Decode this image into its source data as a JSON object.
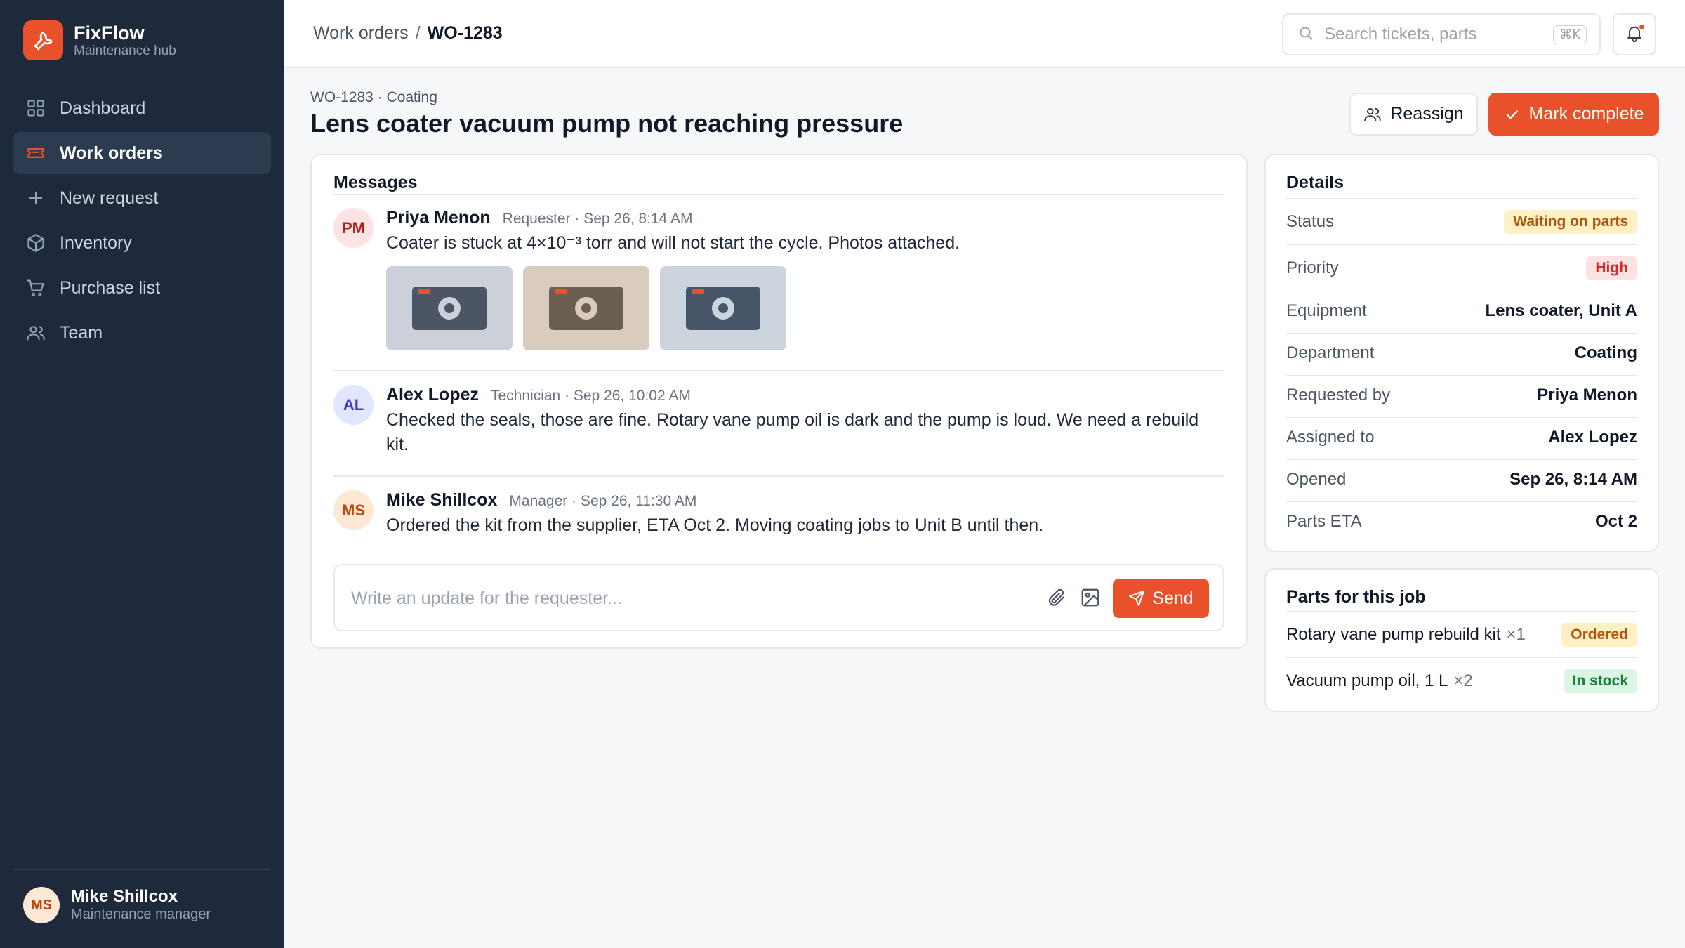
{
  "brand": {
    "name": "FixFlow",
    "subtitle": "Maintenance hub"
  },
  "nav": [
    {
      "label": "Dashboard",
      "icon": "grid-icon",
      "active": false
    },
    {
      "label": "Work orders",
      "icon": "ticket-icon",
      "active": true
    },
    {
      "label": "New request",
      "icon": "plus-icon",
      "active": false
    },
    {
      "label": "Inventory",
      "icon": "box-icon",
      "active": false
    },
    {
      "label": "Purchase list",
      "icon": "cart-icon",
      "active": false
    },
    {
      "label": "Team",
      "icon": "users-icon",
      "active": false
    }
  ],
  "user": {
    "initials": "MS",
    "name": "Mike Shillcox",
    "role": "Maintenance manager"
  },
  "breadcrumb": {
    "parent": "Work orders",
    "separator": "/",
    "current": "WO-1283"
  },
  "search": {
    "placeholder": "Search tickets, parts",
    "shortcut": "⌘K"
  },
  "header": {
    "meta": "WO-1283 · Coating",
    "title": "Lens coater vacuum pump not reaching pressure",
    "reassign_label": "Reassign",
    "complete_label": "Mark complete"
  },
  "messages": {
    "title": "Messages",
    "items": [
      {
        "initials": "PM",
        "name": "Priya Menon",
        "meta": "Requester · Sep 26, 8:14 AM",
        "text": "Coater is stuck at 4×10⁻³ torr and will not start the cycle. Photos attached."
      },
      {
        "initials": "AL",
        "name": "Alex Lopez",
        "meta": "Technician · Sep 26, 10:02 AM",
        "text": "Checked the seals, those are fine. Rotary vane pump oil is dark and the pump is loud. We need a rebuild kit."
      },
      {
        "initials": "MS",
        "name": "Mike Shillcox",
        "meta": "Manager · Sep 26, 11:30 AM",
        "text": "Ordered the kit from the supplier, ETA Oct 2. Moving coating jobs to Unit B until then."
      }
    ],
    "composer_placeholder": "Write an update for the requester...",
    "send_label": "Send"
  },
  "details": {
    "title": "Details",
    "status_label": "Status",
    "status_value": "Waiting on parts",
    "priority_label": "Priority",
    "priority_value": "High",
    "rows": [
      {
        "label": "Equipment",
        "value": "Lens coater, Unit A"
      },
      {
        "label": "Department",
        "value": "Coating"
      },
      {
        "label": "Requested by",
        "value": "Priya Menon"
      },
      {
        "label": "Assigned to",
        "value": "Alex Lopez"
      },
      {
        "label": "Opened",
        "value": "Sep 26, 8:14 AM"
      },
      {
        "label": "Parts ETA",
        "value": "Oct 2"
      }
    ]
  },
  "parts": {
    "title": "Parts for this job",
    "items": [
      {
        "name": "Rotary vane pump rebuild kit",
        "qty": "×1",
        "status": "Ordered"
      },
      {
        "name": "Vacuum pump oil, 1 L",
        "qty": "×2",
        "status": "In stock"
      }
    ]
  },
  "colors": {
    "accent": "#e8512a",
    "sidebar": "#1e293b"
  }
}
